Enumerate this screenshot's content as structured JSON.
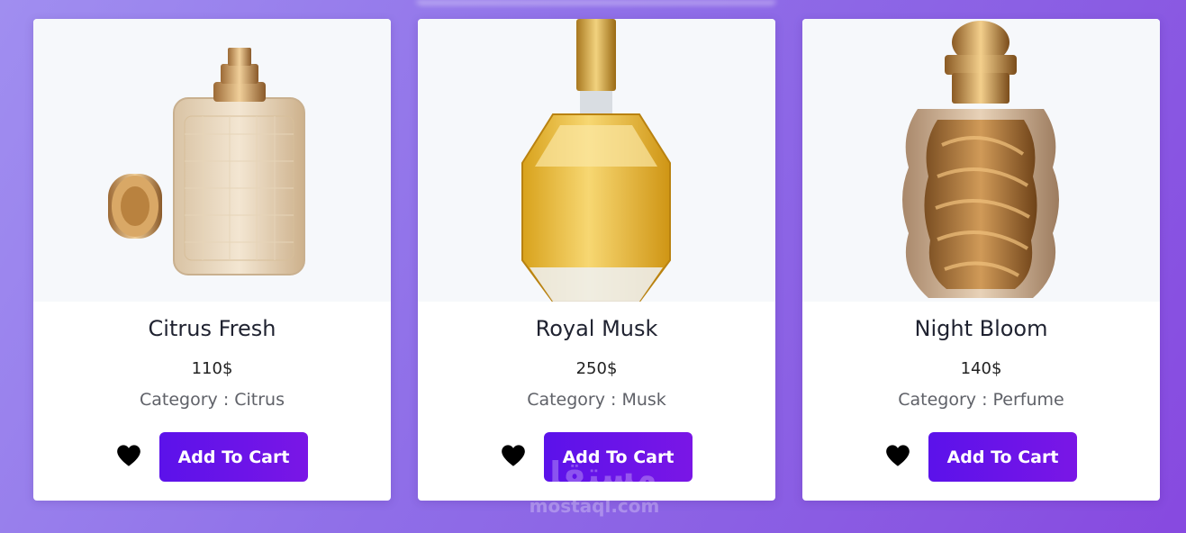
{
  "colors": {
    "background_start": "#a08ef0",
    "background_end": "#8749e0",
    "button_start": "#5b12ea",
    "button_end": "#7a16e6",
    "card": "#ffffff"
  },
  "products": [
    {
      "name": "Citrus Fresh",
      "price": "110$",
      "category": "Category : Citrus",
      "image_icon": "perfume-bottle-glass-icon",
      "button_label": "Add To Cart",
      "favorite_icon": "heart-icon"
    },
    {
      "name": "Royal Musk",
      "price": "250$",
      "category": "Category : Musk",
      "image_icon": "perfume-bottle-amber-icon",
      "button_label": "Add To Cart",
      "favorite_icon": "heart-icon"
    },
    {
      "name": "Night Bloom",
      "price": "140$",
      "category": "Category : Perfume",
      "image_icon": "perfume-bottle-bronze-icon",
      "button_label": "Add To Cart",
      "favorite_icon": "heart-icon"
    }
  ],
  "watermark": {
    "arabic": "مستقل",
    "latin": "mostaql.com"
  }
}
